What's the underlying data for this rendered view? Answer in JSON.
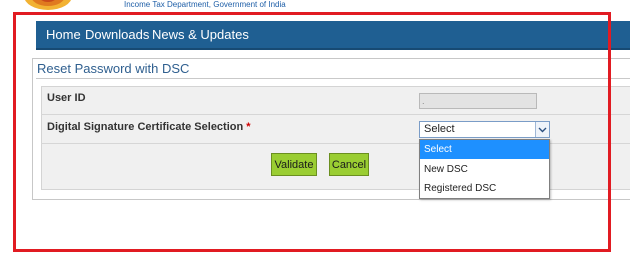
{
  "header": {
    "department_text": "Income Tax Department, Government of India"
  },
  "nav": {
    "items": [
      "Home",
      "Downloads",
      "News & Updates"
    ]
  },
  "panel": {
    "title": "Reset Password with DSC"
  },
  "form": {
    "user_id_label": "User ID",
    "user_id_value": ".",
    "dsc_label": "Digital Signature Certificate Selection",
    "required_mark": "*",
    "dsc_selected": "Select",
    "dsc_options": [
      "Select",
      "New DSC",
      "Registered DSC"
    ]
  },
  "buttons": {
    "validate": "Validate",
    "cancel": "Cancel"
  },
  "colors": {
    "nav_bg": "#1f5f92",
    "button_bg": "#9acd32",
    "highlight_option": "#1e90ff",
    "annotation_frame": "#e11b22"
  }
}
